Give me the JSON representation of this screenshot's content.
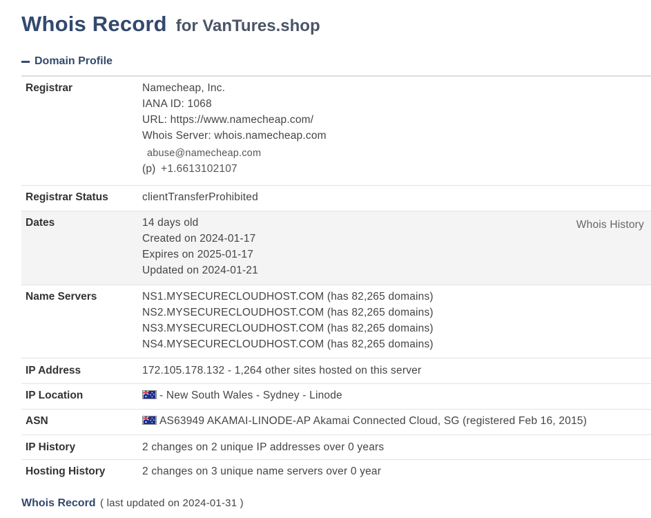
{
  "header": {
    "title_main": "Whois Record",
    "title_sub": "for VanTures.shop"
  },
  "section": {
    "label": "Domain Profile"
  },
  "rows": {
    "registrar": {
      "label": "Registrar",
      "name": "Namecheap, Inc.",
      "iana": "IANA ID: 1068",
      "url": "URL: https://www.namecheap.com/",
      "server": "Whois Server: whois.namecheap.com",
      "email": "abuse@namecheap.com",
      "phone_prefix": "(p)",
      "phone": "+1.6613102107"
    },
    "status": {
      "label": "Registrar Status",
      "value": "clientTransferProhibited"
    },
    "dates": {
      "label": "Dates",
      "age": "14 days old",
      "created": "Created on 2024-01-17",
      "expires": "Expires on 2025-01-17",
      "updated": "Updated on 2024-01-21",
      "history_link": "Whois History"
    },
    "nameservers": {
      "label": "Name Servers",
      "items": [
        "NS1.MYSECURECLOUDHOST.COM (has 82,265 domains)",
        "NS2.MYSECURECLOUDHOST.COM (has 82,265 domains)",
        "NS3.MYSECURECLOUDHOST.COM (has 82,265 domains)",
        "NS4.MYSECURECLOUDHOST.COM (has 82,265 domains)"
      ]
    },
    "ip": {
      "label": "IP Address",
      "value": "172.105.178.132 - 1,264 other sites hosted on this server"
    },
    "location": {
      "label": "IP Location",
      "value": "- New South Wales - Sydney - Linode",
      "flag_icon": "australia-flag-icon"
    },
    "asn": {
      "label": "ASN",
      "value": "AS63949 AKAMAI-LINODE-AP Akamai Connected Cloud, SG (registered Feb 16, 2015)",
      "flag_icon": "australia-flag-icon"
    },
    "ip_history": {
      "label": "IP History",
      "value": "2 changes on 2 unique IP addresses over 0 years"
    },
    "hosting_history": {
      "label": "Hosting History",
      "value": "2 changes on 3 unique name servers over 0 year"
    }
  },
  "footer": {
    "link": "Whois Record",
    "note": "( last updated on 2024-01-31 )"
  },
  "colors": {
    "heading": "#33496e",
    "shaded_row": "#f4f4f4",
    "divider": "#e3e3e3"
  }
}
